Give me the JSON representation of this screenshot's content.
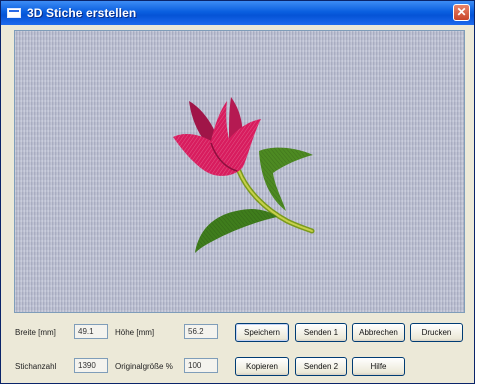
{
  "window": {
    "title": "3D Stiche erstellen"
  },
  "icons": {
    "app": "window-icon",
    "close": "close-icon",
    "close_glyph": "✕"
  },
  "fields": {
    "breite": {
      "label": "Breite [mm]",
      "value": "49.1"
    },
    "hoehe": {
      "label": "Höhe [mm]",
      "value": "56.2"
    },
    "stichanzahl": {
      "label": "Stichanzahl",
      "value": "1390"
    },
    "originalgroesse": {
      "label": "Originalgröße %",
      "value": "100"
    }
  },
  "buttons": {
    "speichern": "Speichern",
    "senden1": "Senden 1",
    "abbrechen": "Abbrechen",
    "drucken": "Drucken",
    "kopieren": "Kopieren",
    "senden2": "Senden 2",
    "hilfe": "Hilfe"
  },
  "colors": {
    "title_bar": "#0553d6",
    "fabric": "#b9bdd0",
    "petal": "#d81c5e",
    "leaf": "#4d8a22"
  }
}
